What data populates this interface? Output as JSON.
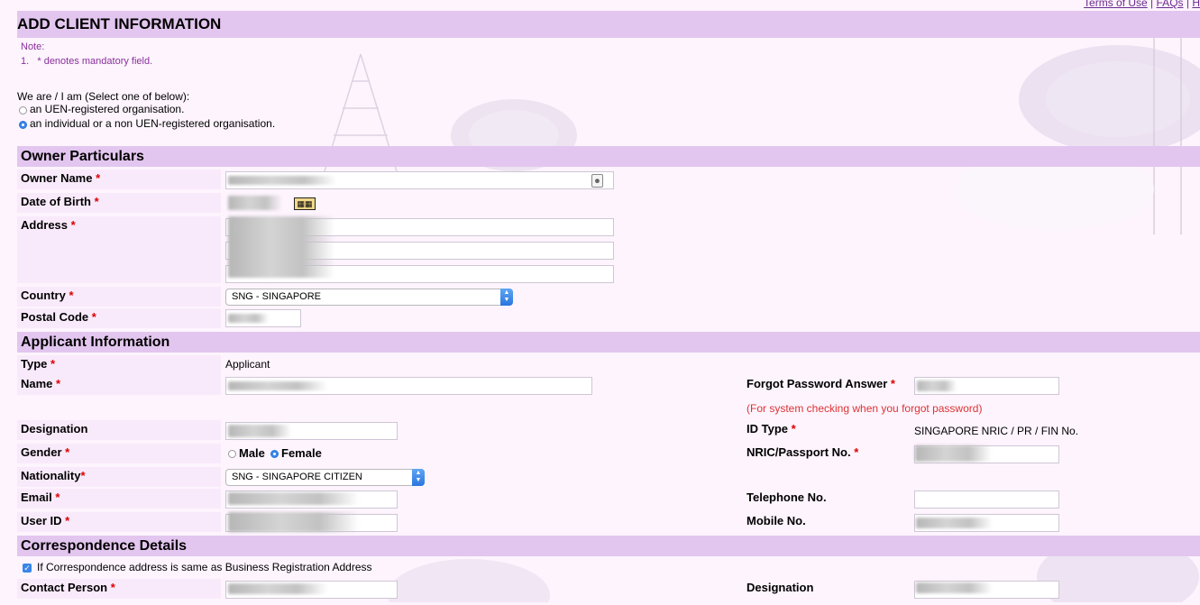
{
  "toplinks": [
    "Terms of Use",
    "FAQs",
    "H"
  ],
  "page_title": "ADD CLIENT INFORMATION",
  "note": {
    "heading": "Note:",
    "item_num": "1.",
    "item_text": "* denotes mandatory field."
  },
  "entity": {
    "prompt": "We are / I am (Select one of below):",
    "options": [
      "an UEN-registered organisation.",
      "an individual or a non UEN-registered organisation."
    ],
    "selected": 1
  },
  "owner": {
    "heading": "Owner Particulars",
    "name_label": "Owner Name",
    "dob_label": "Date of Birth",
    "address_label": "Address",
    "country_label": "Country",
    "country_value": "SNG - SINGAPORE",
    "postal_label": "Postal Code"
  },
  "applicant": {
    "heading": "Applicant Information",
    "type_label": "Type",
    "type_value": "Applicant",
    "name_label": "Name",
    "designation_label": "Designation",
    "gender_label": "Gender",
    "gender_options": [
      "Male",
      "Female"
    ],
    "gender_selected": "Female",
    "nationality_label": "Nationality",
    "nationality_value": "SNG - SINGAPORE CITIZEN",
    "email_label": "Email",
    "userid_label": "User ID",
    "forgot_label": "Forgot Password Answer",
    "forgot_hint": "(For system checking when you forgot password)",
    "idtype_label": "ID Type",
    "idtype_value": "SINGAPORE NRIC / PR / FIN No.",
    "nric_label": "NRIC/Passport No.",
    "telephone_label": "Telephone No.",
    "mobile_label": "Mobile No."
  },
  "correspondence": {
    "heading": "Correspondence Details",
    "same_checkbox": "If Correspondence address is same as Business Registration Address",
    "contact_label": "Contact Person",
    "designation_label": "Designation"
  },
  "mandatory_marker": "*",
  "colors": {
    "section_bar": "#e3c6ef",
    "background": "#fdf4fd",
    "note_text": "#8a2f9c",
    "mandatory": "#dd0000",
    "hint": "#dd3333",
    "accent": "#3a86e8"
  },
  "icons": {
    "contact_card": "contact-card-icon",
    "calendar": "calendar-icon",
    "select_arrow": "chevron-updown-icon"
  }
}
